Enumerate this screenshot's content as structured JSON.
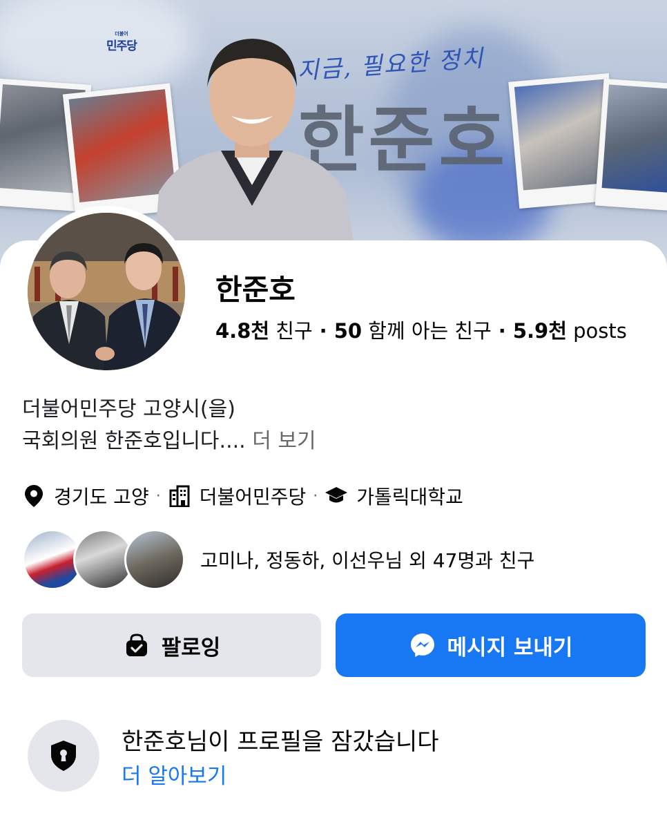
{
  "cover": {
    "party_logo_small": "더불어",
    "party_logo": "민주당",
    "slogan": "지금, 필요한 정치",
    "name_overlay": "한준호"
  },
  "profile": {
    "name": "한준호",
    "friends_count": "4.8천",
    "friends_label": "친구",
    "mutual_count": "50",
    "mutual_label": "함께 아는 친구",
    "posts_count": "5.9천",
    "posts_label": "posts",
    "separator": "·",
    "bio_line1": "더불어민주당 고양시(을)",
    "bio_line2": "국회의원 한준호입니다....",
    "bio_more": "더 보기",
    "details": {
      "location": "경기도 고양",
      "workplace": "더불어민주당",
      "education": "가톨릭대학교",
      "separator": "·"
    },
    "mutual_friends_text": "고미나, 정동하, 이선우님 외 47명과 친구"
  },
  "buttons": {
    "follow_label": "팔로잉",
    "message_label": "메시지 보내기"
  },
  "lock_notice": {
    "title": "한준호님이 프로필을 잠갔습니다",
    "link": "더 알아보기"
  },
  "colors": {
    "accent": "#1877f2",
    "secondary_button": "#e4e6eb",
    "muted_text": "#65676b"
  },
  "icons": {
    "location": "map-pin-icon",
    "workplace": "building-icon",
    "education": "graduation-cap-icon",
    "follow": "following-check-icon",
    "message": "messenger-icon",
    "lock": "shield-lock-icon"
  }
}
